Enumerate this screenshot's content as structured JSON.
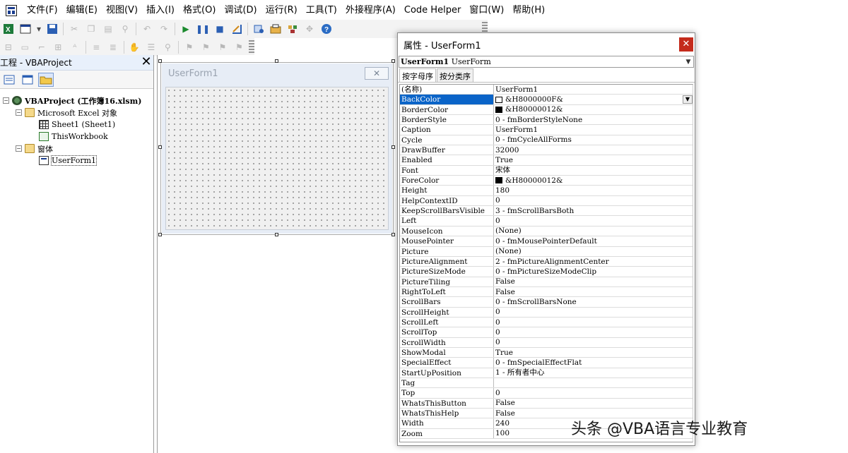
{
  "menubar": {
    "items": [
      "文件(F)",
      "编辑(E)",
      "视图(V)",
      "插入(I)",
      "格式(O)",
      "调试(D)",
      "运行(R)",
      "工具(T)",
      "外接程序(A)",
      "Code Helper",
      "窗口(W)",
      "帮助(H)"
    ]
  },
  "project": {
    "title": "工程 - VBAProject",
    "close": "✕",
    "root": "VBAProject (工作簿16.xlsm)",
    "excel_objects": "Microsoft Excel 对象",
    "sheet1": "Sheet1 (Sheet1)",
    "thisworkbook": "ThisWorkbook",
    "forms_folder": "窗体",
    "userform": "UserForm1"
  },
  "designer": {
    "form_caption": "UserForm1",
    "close_glyph": "✕"
  },
  "properties": {
    "title": "属性 - UserForm1",
    "close": "✕",
    "object_name": "UserForm1",
    "object_type": "UserForm",
    "tab_alpha": "按字母序",
    "tab_category": "按分类序",
    "rows": [
      {
        "name": "(名称)",
        "value": "UserForm1"
      },
      {
        "name": "BackColor",
        "value": "&H8000000F&",
        "swatch": "#ffffff",
        "selected": true
      },
      {
        "name": "BorderColor",
        "value": "&H80000012&",
        "swatch": "#000000"
      },
      {
        "name": "BorderStyle",
        "value": "0 - fmBorderStyleNone"
      },
      {
        "name": "Caption",
        "value": "UserForm1"
      },
      {
        "name": "Cycle",
        "value": "0 - fmCycleAllForms"
      },
      {
        "name": "DrawBuffer",
        "value": "32000"
      },
      {
        "name": "Enabled",
        "value": "True"
      },
      {
        "name": "Font",
        "value": "宋体"
      },
      {
        "name": "ForeColor",
        "value": "&H80000012&",
        "swatch": "#000000"
      },
      {
        "name": "Height",
        "value": "180"
      },
      {
        "name": "HelpContextID",
        "value": "0"
      },
      {
        "name": "KeepScrollBarsVisible",
        "value": "3 - fmScrollBarsBoth"
      },
      {
        "name": "Left",
        "value": "0"
      },
      {
        "name": "MouseIcon",
        "value": "(None)"
      },
      {
        "name": "MousePointer",
        "value": "0 - fmMousePointerDefault"
      },
      {
        "name": "Picture",
        "value": "(None)"
      },
      {
        "name": "PictureAlignment",
        "value": "2 - fmPictureAlignmentCenter"
      },
      {
        "name": "PictureSizeMode",
        "value": "0 - fmPictureSizeModeClip"
      },
      {
        "name": "PictureTiling",
        "value": "False"
      },
      {
        "name": "RightToLeft",
        "value": "False"
      },
      {
        "name": "ScrollBars",
        "value": "0 - fmScrollBarsNone"
      },
      {
        "name": "ScrollHeight",
        "value": "0"
      },
      {
        "name": "ScrollLeft",
        "value": "0"
      },
      {
        "name": "ScrollTop",
        "value": "0"
      },
      {
        "name": "ScrollWidth",
        "value": "0"
      },
      {
        "name": "ShowModal",
        "value": "True"
      },
      {
        "name": "SpecialEffect",
        "value": "0 - fmSpecialEffectFlat"
      },
      {
        "name": "StartUpPosition",
        "value": "1 - 所有者中心"
      },
      {
        "name": "Tag",
        "value": ""
      },
      {
        "name": "Top",
        "value": "0"
      },
      {
        "name": "WhatsThisButton",
        "value": "False"
      },
      {
        "name": "WhatsThisHelp",
        "value": "False"
      },
      {
        "name": "Width",
        "value": "240"
      },
      {
        "name": "Zoom",
        "value": "100"
      }
    ]
  },
  "watermark": "头条 @VBA语言专业教育",
  "icons": {
    "toolbar1": [
      "excel-icon",
      "insert-userform-icon",
      "dropdown-arrow-icon",
      "save-icon",
      "cut-icon",
      "copy-icon",
      "paste-icon",
      "find-icon",
      "undo-icon",
      "redo-icon",
      "run-icon",
      "break-icon",
      "reset-icon",
      "design-mode-icon",
      "project-explorer-icon",
      "properties-window-icon",
      "object-browser-icon",
      "toolbox-icon",
      "help-icon"
    ],
    "toolbar2": [
      "align-icon",
      "make-same-size-icon",
      "size-to-fit-icon",
      "size-to-grid-icon",
      "bring-to-front-icon",
      "center-icon",
      "group-icon",
      "ungroup-icon",
      "order-icon",
      "zoom-icon",
      "indent-icon",
      "outdent-icon",
      "bookmark-icon",
      "toolbar-options-icon"
    ]
  },
  "colors": {
    "selection": "#0a64c8",
    "close_red": "#c42b1c"
  }
}
